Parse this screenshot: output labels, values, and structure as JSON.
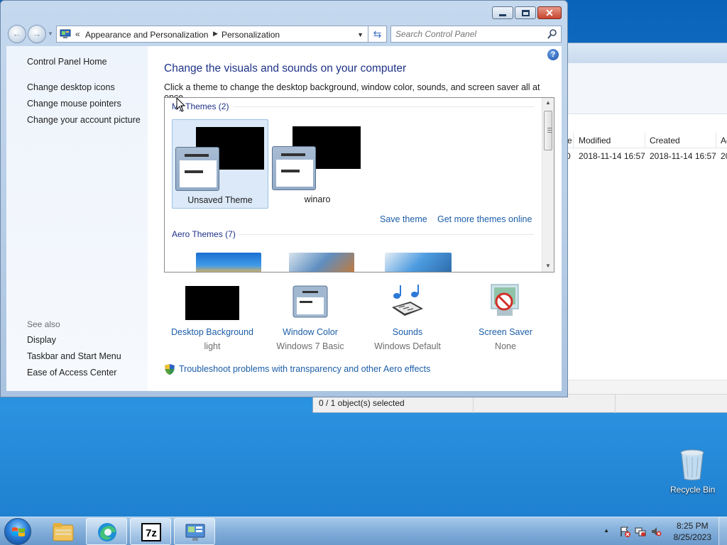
{
  "background_window": {
    "columns": [
      "Modified",
      "Created",
      "Ac"
    ],
    "col_partial": "e",
    "row": {
      "partial": "0",
      "modified": "2018-11-14 16:57",
      "created": "2018-11-14 16:57",
      "accessed_partial": "20"
    },
    "status": "0 / 1 object(s) selected"
  },
  "window": {
    "caption_buttons": [
      "minimize",
      "maximize",
      "close"
    ],
    "back_icon": "←",
    "forward_icon": "→",
    "breadcrumb": [
      "Appearance and Personalization",
      "Personalization"
    ],
    "breadcrumb_chevron": "«",
    "search_placeholder": "Search Control Panel",
    "help_label": "?"
  },
  "left_pane": {
    "home": "Control Panel Home",
    "links": [
      "Change desktop icons",
      "Change mouse pointers",
      "Change your account picture"
    ],
    "see_also_label": "See also",
    "see_also": [
      "Display",
      "Taskbar and Start Menu",
      "Ease of Access Center"
    ]
  },
  "main": {
    "title": "Change the visuals and sounds on your computer",
    "subtitle": "Click a theme to change the desktop background, window color, sounds, and screen saver all at once.",
    "my_themes_header": "My Themes (2)",
    "themes": [
      {
        "name": "Unsaved Theme",
        "selected": true
      },
      {
        "name": "winaro",
        "selected": false
      }
    ],
    "save_theme": "Save theme",
    "get_more": "Get more themes online",
    "aero_header": "Aero Themes (7)",
    "settings": [
      {
        "name": "Desktop Background",
        "value": "light"
      },
      {
        "name": "Window Color",
        "value": "Windows 7 Basic"
      },
      {
        "name": "Sounds",
        "value": "Windows Default"
      },
      {
        "name": "Screen Saver",
        "value": "None"
      }
    ],
    "troubleshoot": "Troubleshoot problems with transparency and other Aero effects"
  },
  "desktop": {
    "recycle_bin": "Recycle Bin"
  },
  "taskbar": {
    "time": "8:25 PM",
    "date": "8/25/2023",
    "apps": [
      "file-explorer-icon",
      "edge-icon",
      "7zip-icon",
      "control-panel-icon"
    ],
    "active_app": "control-panel-icon"
  },
  "colors": {
    "link": "#1c5ea8",
    "heading": "#1e3287",
    "selection": "#dbe9f8"
  }
}
